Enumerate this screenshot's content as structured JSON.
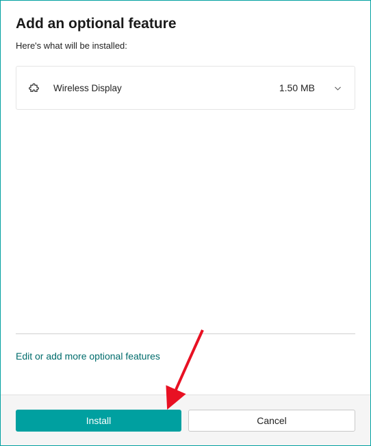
{
  "dialog": {
    "title": "Add an optional feature",
    "subtitle": "Here's what will be installed:"
  },
  "features": [
    {
      "name": "Wireless Display",
      "size": "1.50 MB",
      "icon": "puzzle-icon"
    }
  ],
  "link": {
    "label": "Edit or add more optional features"
  },
  "buttons": {
    "install": "Install",
    "cancel": "Cancel"
  },
  "colors": {
    "accent": "#00a0a0",
    "link": "#006c6c"
  }
}
